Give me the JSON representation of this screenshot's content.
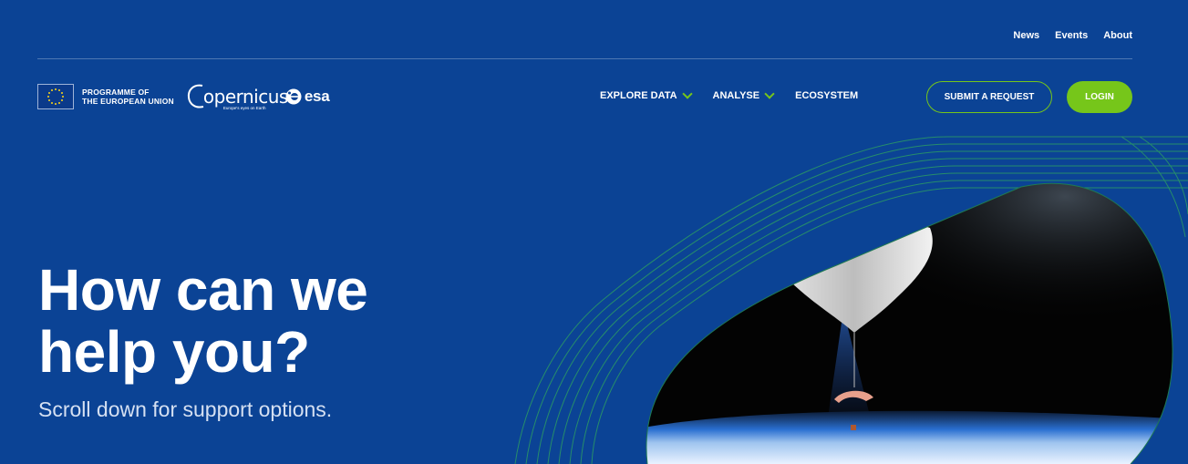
{
  "top_nav": {
    "news": "News",
    "events": "Events",
    "about": "About"
  },
  "logos": {
    "eu_line1": "PROGRAMME OF",
    "eu_line2": "THE EUROPEAN UNION",
    "copernicus_word": "opernicus",
    "copernicus_tagline": "Europe's eyes on Earth",
    "esa_word": "esa"
  },
  "main_nav": {
    "explore_data": "EXPLORE DATA",
    "analyse": "ANALYSE",
    "ecosystem": "ECOSYSTEM"
  },
  "actions": {
    "submit_request": "SUBMIT A REQUEST",
    "login": "LOGIN"
  },
  "hero": {
    "title": "How can we help you?",
    "subtitle": "Scroll down for support options."
  },
  "colors": {
    "background": "#0b4395",
    "accent": "#76c61a"
  }
}
